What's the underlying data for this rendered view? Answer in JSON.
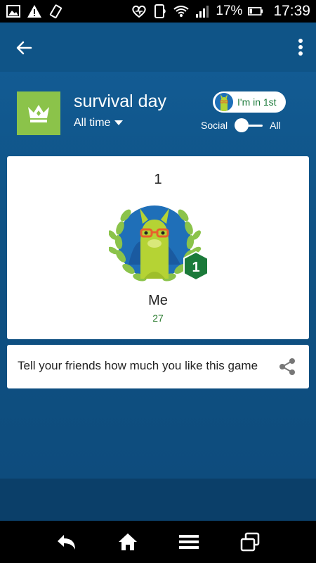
{
  "status_bar": {
    "battery": "17%",
    "time": "17:39"
  },
  "app_bar": {
    "back_icon": "arrow-left-icon",
    "menu_icon": "more-vert-icon"
  },
  "leaderboard": {
    "title": "survival day",
    "time_filter": "All time",
    "rank_chip_label": "I'm in 1st",
    "toggle_left": "Social",
    "toggle_right": "All",
    "toggle_state": "social"
  },
  "player": {
    "rank": "1",
    "name": "Me",
    "score": "27",
    "badge": "1"
  },
  "share": {
    "text": "Tell your friends how much you like this game"
  },
  "colors": {
    "accent_green": "#8bc34a",
    "badge_green": "#1b7a3a",
    "background_blue": "#0f5284"
  }
}
